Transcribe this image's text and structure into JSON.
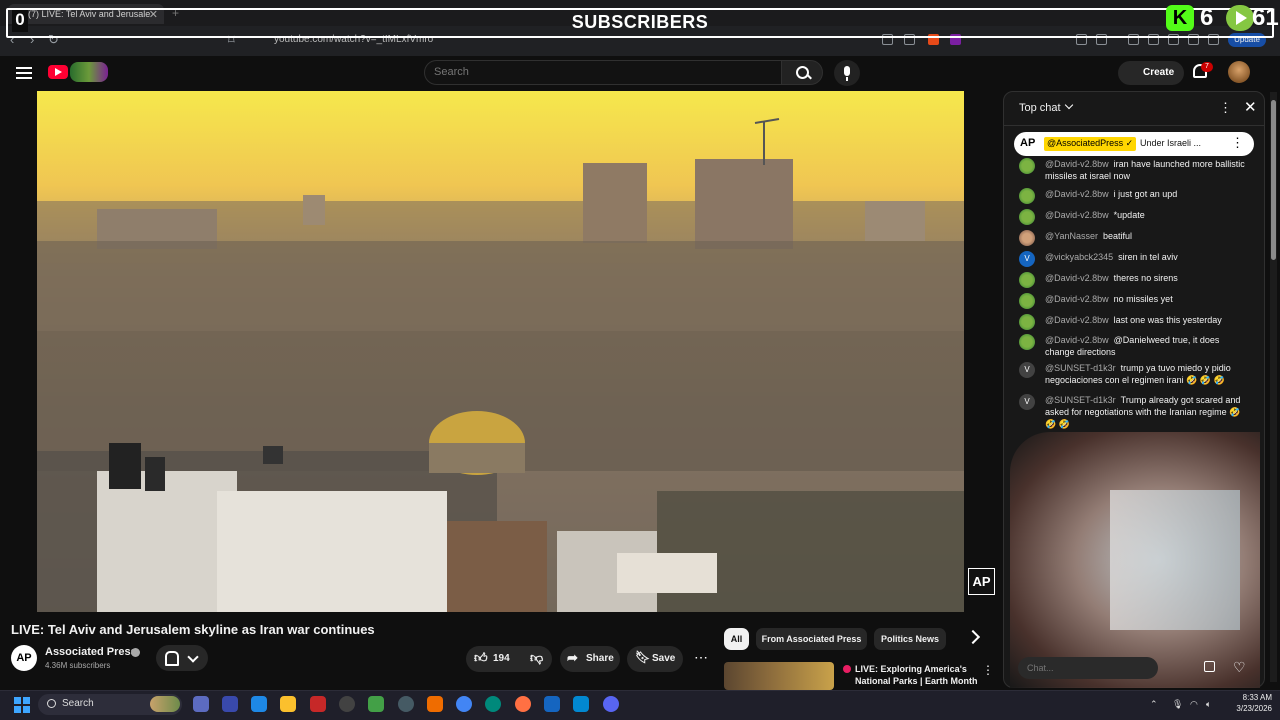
{
  "browser": {
    "tab_title": "(7) LIVE: Tel Aviv and Jerusale",
    "url": "youtube.com/watch?v=_tIMLxfVmro",
    "update_label": "Update"
  },
  "overlay": {
    "banner_title": "SUBSCRIBERS",
    "left_count": "0",
    "kick_count": "6",
    "rumble_count": "61"
  },
  "youtube": {
    "search_placeholder": "Search",
    "create_label": "Create",
    "notification_count": "7"
  },
  "video": {
    "title": "LIVE: Tel Aviv and Jerusalem skyline as Iran war continues",
    "watermark": "AP",
    "channel": {
      "avatar_text": "AP",
      "name": "Associated Press",
      "subscribers": "4.36M subscribers"
    },
    "actions": {
      "likes": "194",
      "share": "Share",
      "save": "Save"
    }
  },
  "chips": [
    "All",
    "From Associated Press",
    "Politics News"
  ],
  "related": {
    "title": "LIVE: Exploring America's National Parks | Earth Month ..."
  },
  "chat": {
    "mode": "Top chat",
    "pinned": {
      "badge": "AP",
      "author": "@AssociatedPress ✓",
      "text": "Under Israeli ..."
    },
    "messages": [
      {
        "user": "@David-v2.8bw",
        "text": "iran have launched more ballistic missiles at israel now",
        "avatar": "lime"
      },
      {
        "user": "@David-v2.8bw",
        "text": "i just got an upd",
        "avatar": "lime"
      },
      {
        "user": "@David-v2.8bw",
        "text": "*update",
        "avatar": "lime"
      },
      {
        "user": "@YanNasser",
        "text": "beatiful",
        "avatar": "photo"
      },
      {
        "user": "@vickyabck2345",
        "text": "siren in tel aviv",
        "avatar": "blue",
        "initial": "V"
      },
      {
        "user": "@David-v2.8bw",
        "text": "theres no sirens",
        "avatar": "lime"
      },
      {
        "user": "@David-v2.8bw",
        "text": "no missiles yet",
        "avatar": "lime"
      },
      {
        "user": "@David-v2.8bw",
        "text": "last one was this yesterday",
        "avatar": "lime"
      },
      {
        "user": "@David-v2.8bw",
        "text": "@Danielweed true, it does change directions",
        "avatar": "lime"
      },
      {
        "user": "@SUNSET-d1k3r",
        "text": "trump ya tuvo miedo y pidio negociaciones con el regimen irani 🤣 🤣 🤣",
        "avatar": "gray",
        "initial": "V"
      },
      {
        "user": "@SUNSET-d1k3r",
        "text": "Trump already got scared and asked for negotiations with the Iranian regime 🤣 🤣 🤣",
        "avatar": "gray",
        "initial": "V"
      }
    ],
    "input_placeholder": "Chat..."
  },
  "taskbar": {
    "search_label": "Search",
    "time": "8:33 AM",
    "date": "3/23/2026"
  }
}
